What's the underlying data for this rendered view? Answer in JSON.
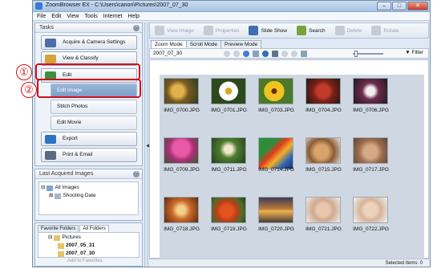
{
  "window": {
    "title": "ZoomBrowser EX - C:\\Users\\canon\\Pictures\\2007_07_30"
  },
  "controls": {
    "minimize": "–",
    "maximize": "□",
    "close": "✕"
  },
  "menu": [
    "File",
    "Edit",
    "View",
    "Tools",
    "Internet",
    "Help"
  ],
  "tasks": {
    "header": "Tasks",
    "items": [
      {
        "label": "Acquire & Camera Settings",
        "icon": "camera-icon",
        "color": "#4b6fa8"
      },
      {
        "label": "View & Classify",
        "icon": "folder-view-icon",
        "color": "#d6a23c"
      },
      {
        "label": "Edit",
        "icon": "edit-brush-icon",
        "color": "#3f8d3f"
      },
      {
        "label": "Export",
        "icon": "export-icon",
        "color": "#2d73c5"
      },
      {
        "label": "Print & Email",
        "icon": "printer-icon",
        "color": "#5a6a80"
      }
    ],
    "edit_sub": [
      "Edit Image",
      "Stitch Photos",
      "Edit Movie"
    ]
  },
  "callouts": [
    "①",
    "②"
  ],
  "last_acquired": {
    "header": "Last Acquired Images",
    "items": [
      "All Images",
      "Shooting Date"
    ]
  },
  "favorites": {
    "tabs": [
      "Favorite Folders",
      "All Folders"
    ],
    "items": [
      "Pictures",
      "2007_05_31",
      "2007_07_30",
      "2007_08_03"
    ],
    "add_label": "Add to Favorites"
  },
  "toolbar": [
    "View Image",
    "Properties",
    "Slide Show",
    "Search",
    "Delete",
    "Rotate"
  ],
  "view_tabs": [
    "Zoom Mode",
    "Scroll Mode",
    "Preview Mode"
  ],
  "folder_path": "2007_07_30",
  "filter_label": "Filter",
  "thumbnails": [
    "IMG_0700.JPG",
    "IMG_0701.JPG",
    "IMG_0703.JPG",
    "IMG_0704.JPG",
    "IMG_0706.JPG",
    "IMG_0709.JPG",
    "IMG_0711.JPG",
    "IMG_0714.JPG",
    "IMG_0715.JPG",
    "IMG_0717.JPG",
    "IMG_0718.JPG",
    "IMG_0719.JPG",
    "IMG_0720.JPG",
    "IMG_0721.JPG",
    "IMG_0722.JPG"
  ],
  "status": "Selected Items: 0"
}
